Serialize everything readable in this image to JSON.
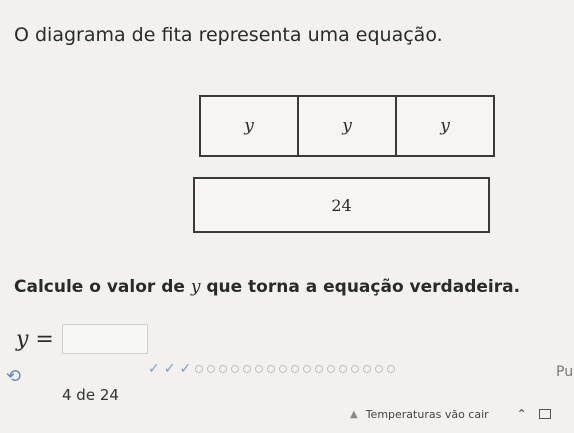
{
  "prompt": "O diagrama de fita representa uma equação.",
  "tape": {
    "top_cells": [
      "y",
      "y",
      "y"
    ],
    "bottom_value": "24"
  },
  "question": {
    "prefix": "Calcule o valor de ",
    "variable": "y",
    "suffix": " que torna a equação verdadeira."
  },
  "answer": {
    "label": "y =",
    "value": ""
  },
  "progress": {
    "text": "4 de 24",
    "completed": 3,
    "total": 24,
    "next_label_partial": "Pu"
  },
  "taskbar": {
    "weather_text": "Temperaturas vão cair"
  }
}
